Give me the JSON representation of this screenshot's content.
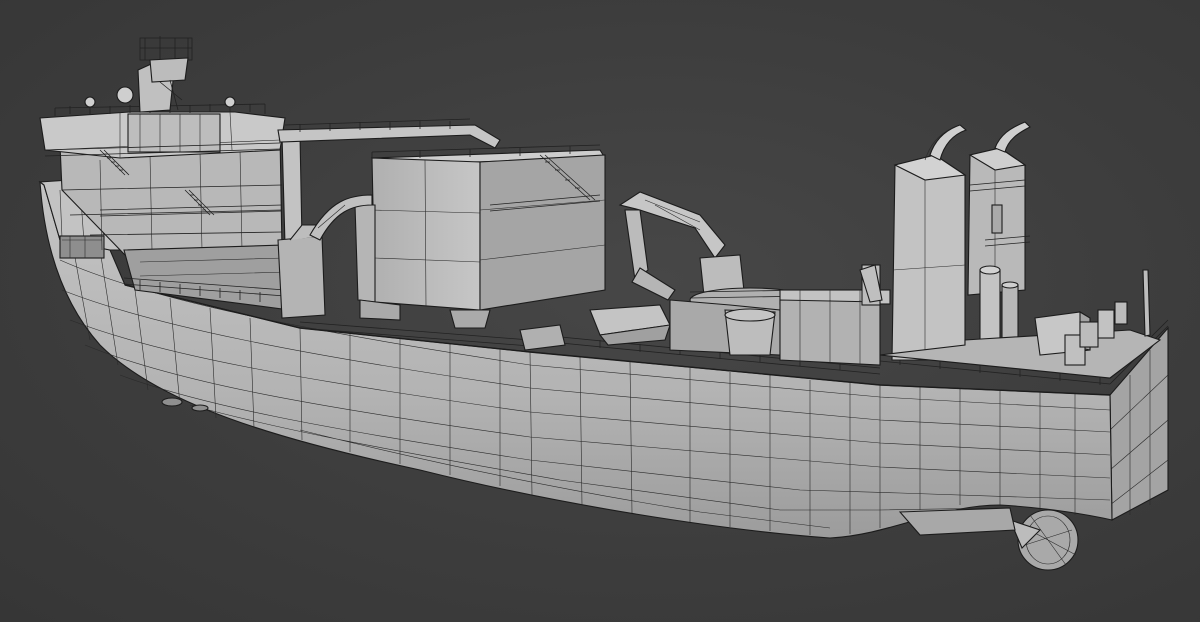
{
  "scene": {
    "background": "#3d3d3d",
    "model_fill": "#b9b9b9",
    "model_fill_light": "#c8c8c8",
    "model_fill_shadow": "#9a9a9a",
    "wire_color": "#2a2a2a",
    "style": "3d-wireframe-viewport-render"
  }
}
